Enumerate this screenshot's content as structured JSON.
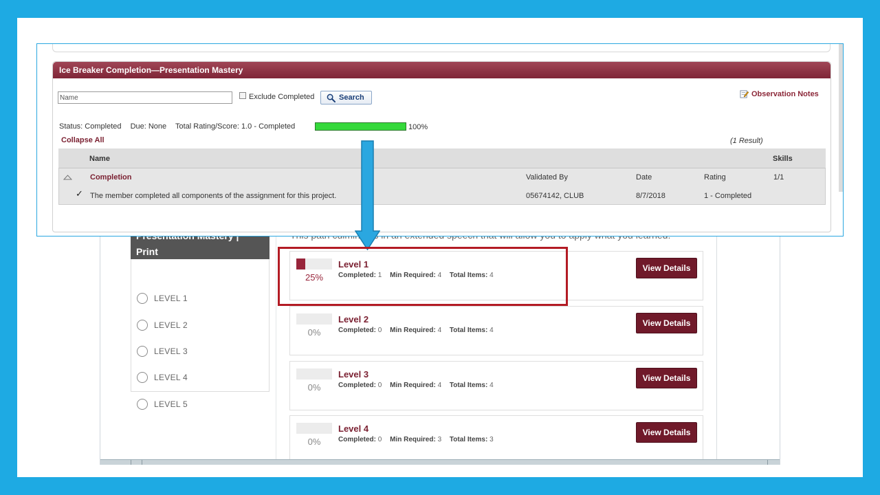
{
  "colors": {
    "background": "#1eaae3",
    "accent": "#7a1f30",
    "button": "#701a2a",
    "progress_green": "#35d93b",
    "highlight_box": "#b31b24",
    "arrow": "#2aa7e0"
  },
  "completion_panel": {
    "title": "Ice Breaker Completion—Presentation Mastery",
    "name_placeholder": "Name",
    "exclude_completed_label": "Exclude Completed",
    "exclude_completed_checked": false,
    "search_label": "Search",
    "search_icon": "magnifier-icon",
    "observation_notes_label": "Observation Notes",
    "observation_notes_icon": "note-pencil-icon",
    "status": "Status: Completed",
    "due": "Due: None",
    "total_rating": "Total Rating/Score: 1.0 - Completed",
    "progress_value": 1.0,
    "progress_label": "100%",
    "collapse_all_label": "Collapse All",
    "result_count": "(1 Result)",
    "table": {
      "headers": {
        "name": "Name",
        "skills": "Skills"
      },
      "group": {
        "title": "Completion",
        "validated_by_header": "Validated By",
        "date_header": "Date",
        "rating_header": "Rating",
        "skills_value": "1/1"
      },
      "rows": [
        {
          "text": "The member completed all components of the assignment for this project.",
          "validated_by": "05674142, CLUB",
          "date": "8/7/2018",
          "rating": "1 - Completed"
        }
      ]
    }
  },
  "pathway_page": {
    "header_line1": "Presentation Mastery |",
    "header_line2": "Print",
    "intro_text": "This path culminates in an extended speech that will allow you to apply what you learned.",
    "menu": [
      {
        "label": "LEVEL 1"
      },
      {
        "label": "LEVEL 2"
      },
      {
        "label": "LEVEL 3"
      },
      {
        "label": "LEVEL 4"
      },
      {
        "label": "LEVEL 5"
      }
    ],
    "stat_labels": {
      "completed": "Completed:",
      "min_required": "Min Required:",
      "total_items": "Total Items:"
    },
    "view_details_label": "View Details",
    "levels": [
      {
        "name": "Level 1",
        "progress": 0.25,
        "percent_label": "25%",
        "completed": "1",
        "min_required": "4",
        "total_items": "4"
      },
      {
        "name": "Level 2",
        "progress": 0,
        "percent_label": "0%",
        "completed": "0",
        "min_required": "4",
        "total_items": "4"
      },
      {
        "name": "Level 3",
        "progress": 0,
        "percent_label": "0%",
        "completed": "0",
        "min_required": "4",
        "total_items": "4"
      },
      {
        "name": "Level 4",
        "progress": 0,
        "percent_label": "0%",
        "completed": "0",
        "min_required": "3",
        "total_items": "3"
      }
    ]
  }
}
